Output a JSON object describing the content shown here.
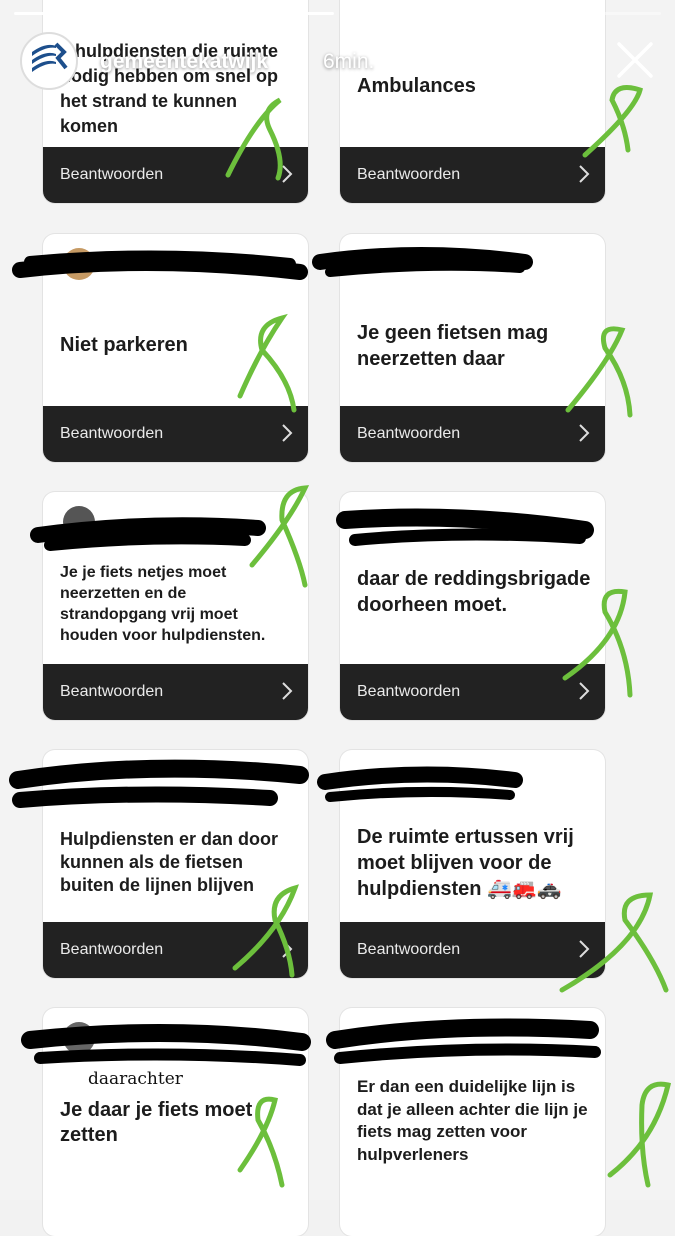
{
  "story": {
    "username": "gemeentekatwijk",
    "time": "6min.",
    "progress_segments": 6,
    "current_segment": 6
  },
  "footer_label": "Beantwoorden",
  "cards": [
    {
      "text": "e hulpdiensten die ruimte nodig hebben om snel op het strand te kunnen komen"
    },
    {
      "text": "Ambulances"
    },
    {
      "text": "Niet parkeren"
    },
    {
      "text": "Je geen fietsen mag neerzetten daar"
    },
    {
      "text": "Je je fiets netjes moet neerzetten en de strandopgang vrij moet houden voor hulpdiensten."
    },
    {
      "text": "daar de reddingsbrigade doorheen moet."
    },
    {
      "text": "Hulpdiensten er dan door kunnen als de fietsen buiten de lijnen blijven"
    },
    {
      "text": "De ruimte ertussen vrij moet blijven voor de hulpdiensten 🚑🚒🚓"
    },
    {
      "text": "Je daar je fiets moet zetten"
    },
    {
      "text": "Er dan een duidelijke lijn is dat je alleen achter die lijn je fiets mag zetten voor hulpverleners"
    }
  ],
  "handwritten_note": "daarachter",
  "colors": {
    "footer": "#222222",
    "scribble_green": "#6cbf3c",
    "redaction": "#000000"
  },
  "icons": [
    "close-icon",
    "more-icon",
    "chevron-right-icon",
    "katwijk-logo"
  ]
}
